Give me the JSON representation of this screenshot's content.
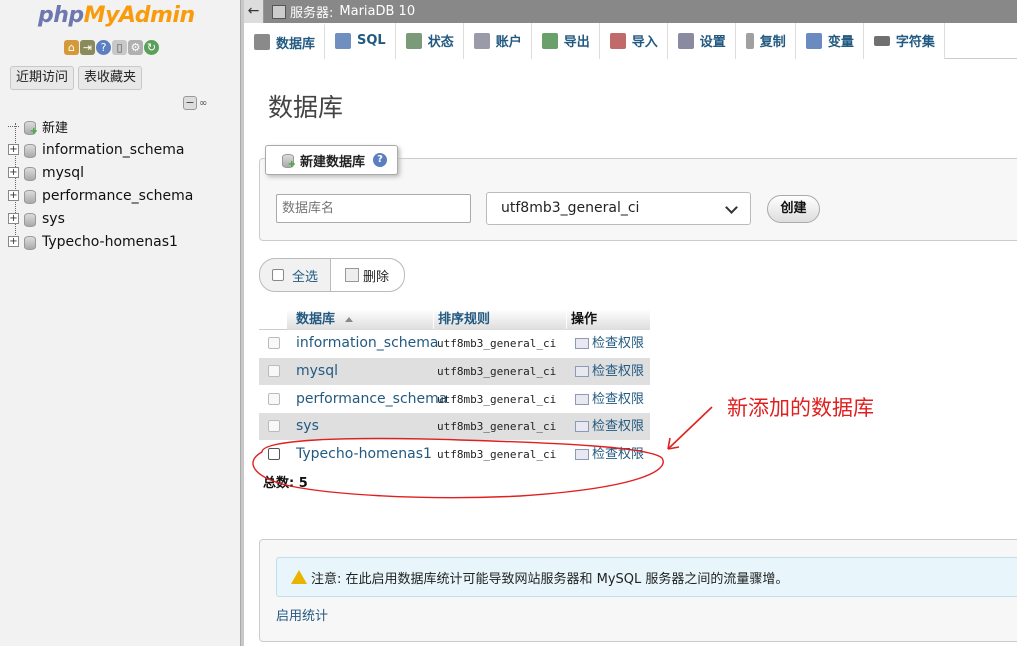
{
  "nav": {
    "logo_php": "php",
    "logo_myadmin": "MyAdmin",
    "icons": [
      "home-icon",
      "exit-icon",
      "help-icon",
      "docs-icon",
      "settings-icon",
      "reload-icon"
    ],
    "tabs": [
      "近期访问",
      "表收藏夹"
    ],
    "tree": [
      {
        "label": "新建",
        "kind": "new"
      },
      {
        "label": "information_schema",
        "kind": "db"
      },
      {
        "label": "mysql",
        "kind": "db"
      },
      {
        "label": "performance_schema",
        "kind": "db"
      },
      {
        "label": "sys",
        "kind": "db"
      },
      {
        "label": "Typecho-homenas1",
        "kind": "db"
      }
    ]
  },
  "topbar": {
    "server_label": "服务器:",
    "server_name": "MariaDB 10"
  },
  "tabs": [
    {
      "label": "数据库",
      "icon": "database-icon",
      "color": "#8a8a8a"
    },
    {
      "label": "SQL",
      "icon": "sql-icon",
      "color": "#6e8fc0"
    },
    {
      "label": "状态",
      "icon": "status-icon",
      "color": "#7a9a7a"
    },
    {
      "label": "账户",
      "icon": "accounts-icon",
      "color": "#9a9aa8"
    },
    {
      "label": "导出",
      "icon": "export-icon",
      "color": "#6aa06a"
    },
    {
      "label": "导入",
      "icon": "import-icon",
      "color": "#c06a6a"
    },
    {
      "label": "设置",
      "icon": "wrench-icon",
      "color": "#8a8aa0"
    },
    {
      "label": "复制",
      "icon": "replication-icon",
      "color": "#a0a0a0"
    },
    {
      "label": "变量",
      "icon": "variables-icon",
      "color": "#6a8ac0"
    },
    {
      "label": "字符集",
      "icon": "charset-icon",
      "color": "#707070"
    }
  ],
  "main": {
    "title": "数据库",
    "create": {
      "legend": "新建数据库",
      "name_placeholder": "数据库名",
      "collation": "utf8mb3_general_ci",
      "button": "创建"
    },
    "bulk": {
      "select_all": "全选",
      "delete": "删除"
    },
    "table": {
      "headers": [
        "数据库",
        "排序规则",
        "操作"
      ],
      "rows": [
        {
          "name": "information_schema",
          "collation": "utf8mb3_general_ci",
          "action": "检查权限"
        },
        {
          "name": "mysql",
          "collation": "utf8mb3_general_ci",
          "action": "检查权限"
        },
        {
          "name": "performance_schema",
          "collation": "utf8mb3_general_ci",
          "action": "检查权限"
        },
        {
          "name": "sys",
          "collation": "utf8mb3_general_ci",
          "action": "检查权限"
        },
        {
          "name": "Typecho-homenas1",
          "collation": "utf8mb3_general_ci",
          "action": "检查权限"
        }
      ],
      "total": "总数: 5"
    },
    "annotation": "新添加的数据库",
    "notice": "注意: 在此启用数据库统计可能导致网站服务器和 MySQL 服务器之间的流量骤增。",
    "enable_stats": "启用统计"
  }
}
